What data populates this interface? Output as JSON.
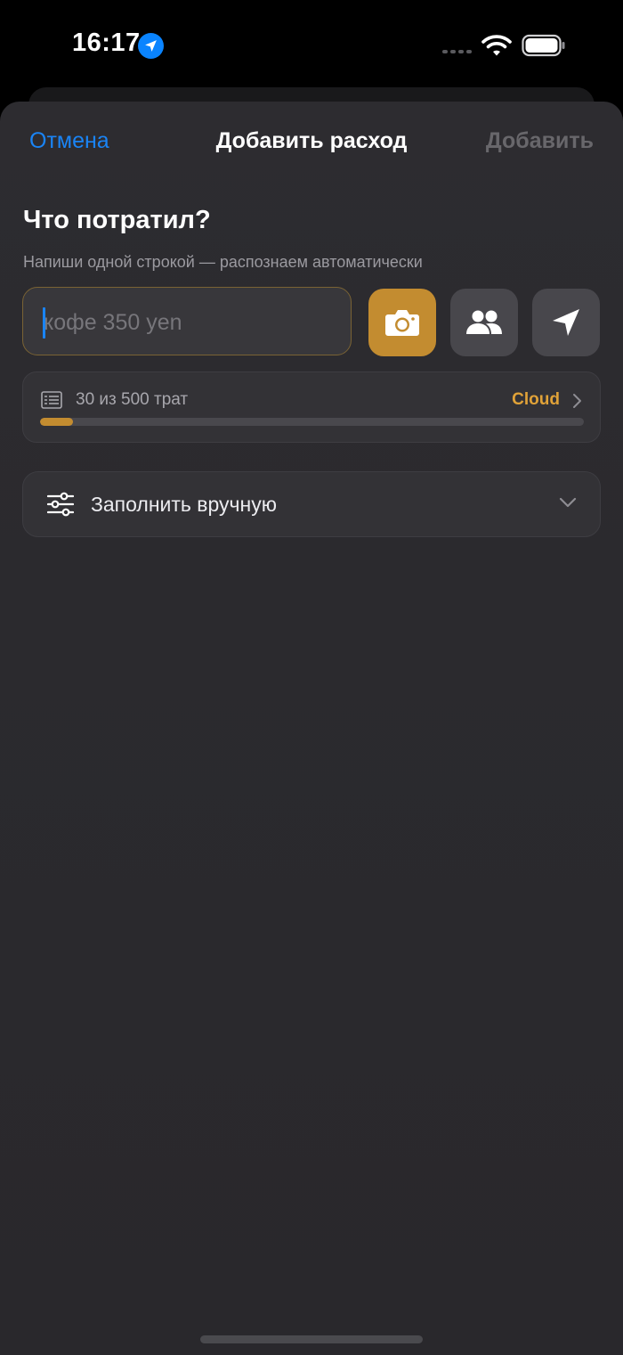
{
  "status_bar": {
    "time": "16:17",
    "location_icon": "location-arrow-icon",
    "signal_icon": "signal-dots-icon",
    "wifi_icon": "wifi-icon",
    "battery_icon": "battery-full-icon"
  },
  "nav": {
    "cancel_label": "Отмена",
    "title": "Добавить расход",
    "add_label": "Добавить"
  },
  "form": {
    "heading": "Что потратил?",
    "hint": "Напиши одной строкой — распознаем автоматически",
    "input_value": "",
    "input_placeholder": "кофе 350 yen",
    "camera_icon": "camera-icon",
    "people_icon": "people-icon",
    "send_icon": "send-arrow-icon"
  },
  "usage": {
    "icon": "receipt-list-icon",
    "text": "30 из 500 трат",
    "plan_label": "Cloud",
    "used": 30,
    "limit": 500,
    "progress_fraction": 0.06
  },
  "manual": {
    "icon": "sliders-icon",
    "label": "Заполнить вручную",
    "chevron_icon": "chevron-down-icon"
  },
  "colors": {
    "accent_blue": "#1a84f5",
    "accent_gold": "#c38c30",
    "plan_gold": "#e0a238",
    "sheet_bg": "#2d2c30"
  }
}
